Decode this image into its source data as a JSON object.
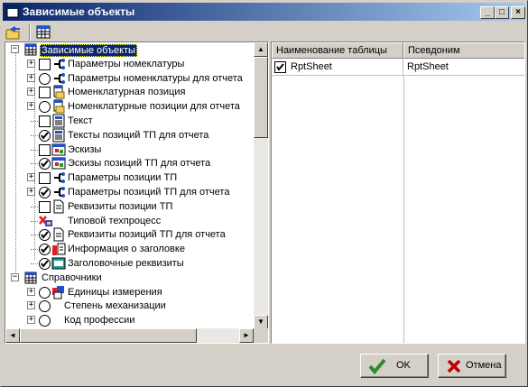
{
  "window": {
    "title": "Зависимые объекты",
    "controls": {
      "minimize": "_",
      "maximize": "□",
      "close": "×"
    }
  },
  "tree": {
    "root1_label": "Зависимые объекты",
    "items": [
      {
        "label": "Параметры номеклатуры",
        "check": "square",
        "checked": false,
        "icon": "parameters-icon",
        "expander": "+"
      },
      {
        "label": "Параметры номенклатуры для отчета",
        "check": "round",
        "checked": false,
        "icon": "parameters-icon",
        "expander": "+"
      },
      {
        "label": "Номенклатурная позиция",
        "check": "square",
        "checked": false,
        "icon": "document-icon",
        "expander": "+"
      },
      {
        "label": "Номенклатурные позиции для отчета",
        "check": "round",
        "checked": false,
        "icon": "document-icon",
        "expander": "+"
      },
      {
        "label": "Текст",
        "check": "square",
        "checked": false,
        "icon": "text-icon",
        "expander": ""
      },
      {
        "label": "Тексты позиций ТП для отчета",
        "check": "round",
        "checked": true,
        "icon": "text-icon",
        "expander": ""
      },
      {
        "label": "Эскизы",
        "check": "square",
        "checked": false,
        "icon": "sketch-icon",
        "expander": ""
      },
      {
        "label": "Эскизы позиций ТП для отчета",
        "check": "round",
        "checked": true,
        "icon": "sketch-icon",
        "expander": ""
      },
      {
        "label": "Параметры позиции ТП",
        "check": "square",
        "checked": false,
        "icon": "parameters-icon",
        "expander": "+"
      },
      {
        "label": "Параметры позиций ТП для отчета",
        "check": "round",
        "checked": true,
        "icon": "parameters-icon",
        "expander": "+"
      },
      {
        "label": "Реквизиты позиции ТП",
        "check": "square",
        "checked": false,
        "icon": "page-icon",
        "expander": ""
      },
      {
        "label": "Типовой техпроцесс",
        "check": "none",
        "checked": false,
        "icon": "process-icon",
        "expander": ""
      },
      {
        "label": "Реквизиты позиций ТП для отчета",
        "check": "round",
        "checked": true,
        "icon": "page-icon",
        "expander": ""
      },
      {
        "label": "Информация о заголовке",
        "check": "round",
        "checked": true,
        "icon": "info-icon",
        "expander": ""
      },
      {
        "label": "Заголовочные реквизиты",
        "check": "round",
        "checked": true,
        "icon": "header-icon",
        "expander": ""
      }
    ],
    "root2_label": "Справочники",
    "items2": [
      {
        "label": "Единицы измерения",
        "check": "round",
        "checked": false,
        "icon": "units-icon",
        "expander": "+"
      },
      {
        "label": "Степень механизации",
        "check": "round",
        "checked": false,
        "icon": "",
        "expander": "+"
      },
      {
        "label": "Код профессии",
        "check": "round",
        "checked": false,
        "icon": "",
        "expander": "+"
      }
    ]
  },
  "grid": {
    "columns": [
      "Наименование таблицы",
      "Псевдоним"
    ],
    "rows": [
      {
        "checked": true,
        "table": "RptSheet",
        "alias": "RptSheet"
      }
    ]
  },
  "buttons": {
    "ok": "OK",
    "cancel": "Отмена"
  },
  "colors": {
    "titlebar_start": "#0a246a",
    "titlebar_end": "#a6caf0",
    "face": "#d4d0c8",
    "ok_check": "#2e8b2e",
    "cancel_x": "#c00000"
  }
}
